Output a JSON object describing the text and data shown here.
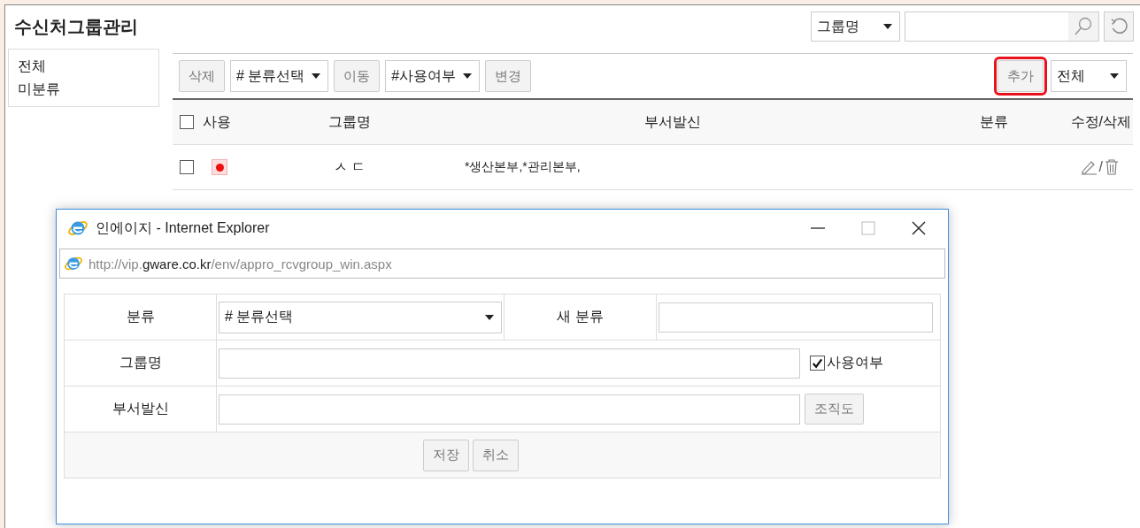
{
  "page": {
    "title": "수신처그룹관리"
  },
  "search": {
    "field": "그룹명"
  },
  "sidebar": {
    "items": [
      {
        "label": "전체"
      },
      {
        "label": "미분류"
      }
    ]
  },
  "toolbar": {
    "items": [
      {
        "kind": "button",
        "label": "삭제"
      },
      {
        "kind": "select",
        "label": "# 분류선택"
      },
      {
        "kind": "button",
        "label": "이동"
      },
      {
        "kind": "select",
        "label": "#사용여부"
      },
      {
        "kind": "button",
        "label": "변경"
      }
    ],
    "add_button": {
      "label": "추가",
      "highlighted": true
    },
    "filter": {
      "value": "전체"
    }
  },
  "table": {
    "all_checked": false,
    "columns": [
      "사용",
      "그룹명",
      "부서발신",
      "분류",
      "수정/삭제"
    ],
    "rows": [
      {
        "checked": false,
        "group": "ㅅ ㄷ",
        "departments": "*생산본부,*관리본부,",
        "separator": "/"
      }
    ]
  },
  "popup": {
    "title": "인에이지 - Internet Explorer",
    "url": [
      {
        "text": "http://vip.",
        "strong": false
      },
      {
        "text": "gware.co.kr",
        "strong": true
      },
      {
        "text": "/env/appro_rcvgroup_win.aspx",
        "strong": false
      }
    ],
    "form": {
      "category_label": "분류",
      "category_select": "# 분류선택",
      "new_category_label": "새 분류",
      "group_label": "그룹명",
      "use_label": "사용여부",
      "use_checked": true,
      "dept_label": "부서발신",
      "org_button": "조직도",
      "save_button": "저장",
      "cancel_button": "취소"
    }
  }
}
